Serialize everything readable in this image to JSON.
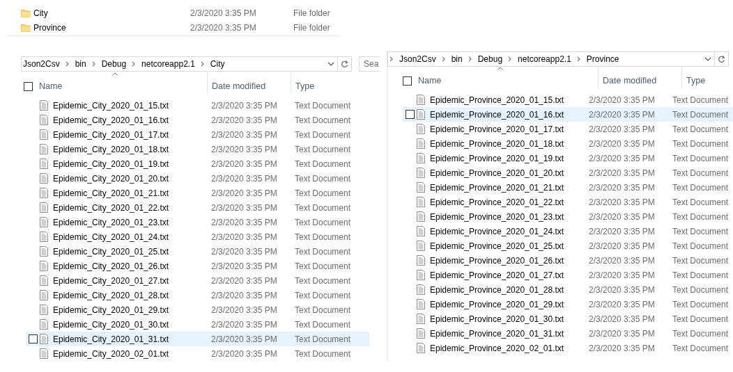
{
  "folders": [
    {
      "name": "City",
      "date_modified": "2/3/2020 3:35 PM",
      "type": "File folder"
    },
    {
      "name": "Province",
      "date_modified": "2/3/2020 3:35 PM",
      "type": "File folder"
    }
  ],
  "panes": [
    {
      "address": {
        "crumbs": [
          "Json2Csv",
          "bin",
          "Debug",
          "netcoreapp2.1",
          "City"
        ],
        "leading_chevron": false
      },
      "search": {
        "placeholder": "Sea"
      },
      "select_all_checked": false,
      "columns": [
        {
          "label": "Name",
          "sorted": true
        },
        {
          "label": "Date modified",
          "sorted": false
        },
        {
          "label": "Type",
          "sorted": false
        }
      ],
      "rows": [
        {
          "name": "Epidemic_City_2020_01_15.txt",
          "date_modified": "2/3/2020 3:35 PM",
          "type": "Text Document",
          "highlighted": false
        },
        {
          "name": "Epidemic_City_2020_01_16.txt",
          "date_modified": "2/3/2020 3:35 PM",
          "type": "Text Document",
          "highlighted": false
        },
        {
          "name": "Epidemic_City_2020_01_17.txt",
          "date_modified": "2/3/2020 3:35 PM",
          "type": "Text Document",
          "highlighted": false
        },
        {
          "name": "Epidemic_City_2020_01_18.txt",
          "date_modified": "2/3/2020 3:35 PM",
          "type": "Text Document",
          "highlighted": false
        },
        {
          "name": "Epidemic_City_2020_01_19.txt",
          "date_modified": "2/3/2020 3:35 PM",
          "type": "Text Document",
          "highlighted": false
        },
        {
          "name": "Epidemic_City_2020_01_20.txt",
          "date_modified": "2/3/2020 3:35 PM",
          "type": "Text Document",
          "highlighted": false
        },
        {
          "name": "Epidemic_City_2020_01_21.txt",
          "date_modified": "2/3/2020 3:35 PM",
          "type": "Text Document",
          "highlighted": false
        },
        {
          "name": "Epidemic_City_2020_01_22.txt",
          "date_modified": "2/3/2020 3:35 PM",
          "type": "Text Document",
          "highlighted": false
        },
        {
          "name": "Epidemic_City_2020_01_23.txt",
          "date_modified": "2/3/2020 3:35 PM",
          "type": "Text Document",
          "highlighted": false
        },
        {
          "name": "Epidemic_City_2020_01_24.txt",
          "date_modified": "2/3/2020 3:35 PM",
          "type": "Text Document",
          "highlighted": false
        },
        {
          "name": "Epidemic_City_2020_01_25.txt",
          "date_modified": "2/3/2020 3:35 PM",
          "type": "Text Document",
          "highlighted": false
        },
        {
          "name": "Epidemic_City_2020_01_26.txt",
          "date_modified": "2/3/2020 3:35 PM",
          "type": "Text Document",
          "highlighted": false
        },
        {
          "name": "Epidemic_City_2020_01_27.txt",
          "date_modified": "2/3/2020 3:35 PM",
          "type": "Text Document",
          "highlighted": false
        },
        {
          "name": "Epidemic_City_2020_01_28.txt",
          "date_modified": "2/3/2020 3:35 PM",
          "type": "Text Document",
          "highlighted": false
        },
        {
          "name": "Epidemic_City_2020_01_29.txt",
          "date_modified": "2/3/2020 3:35 PM",
          "type": "Text Document",
          "highlighted": false
        },
        {
          "name": "Epidemic_City_2020_01_30.txt",
          "date_modified": "2/3/2020 3:35 PM",
          "type": "Text Document",
          "highlighted": false
        },
        {
          "name": "Epidemic_City_2020_01_31.txt",
          "date_modified": "2/3/2020 3:35 PM",
          "type": "Text Document",
          "highlighted": true
        },
        {
          "name": "Epidemic_City_2020_02_01.txt",
          "date_modified": "2/3/2020 3:35 PM",
          "type": "Text Document",
          "highlighted": false
        }
      ]
    },
    {
      "address": {
        "crumbs": [
          "Json2Csv",
          "bin",
          "Debug",
          "netcoreapp2.1",
          "Province"
        ],
        "leading_chevron": true
      },
      "select_all_checked": false,
      "columns": [
        {
          "label": "Name",
          "sorted": true
        },
        {
          "label": "Date modified",
          "sorted": false
        },
        {
          "label": "Type",
          "sorted": false
        }
      ],
      "rows": [
        {
          "name": "Epidemic_Province_2020_01_15.txt",
          "date_modified": "2/3/2020 3:35 PM",
          "type": "Text Document",
          "highlighted": false
        },
        {
          "name": "Epidemic_Province_2020_01_16.txt",
          "date_modified": "2/3/2020 3:35 PM",
          "type": "Text Document",
          "highlighted": true
        },
        {
          "name": "Epidemic_Province_2020_01_17.txt",
          "date_modified": "2/3/2020 3:35 PM",
          "type": "Text Document",
          "highlighted": false
        },
        {
          "name": "Epidemic_Province_2020_01_18.txt",
          "date_modified": "2/3/2020 3:35 PM",
          "type": "Text Document",
          "highlighted": false
        },
        {
          "name": "Epidemic_Province_2020_01_19.txt",
          "date_modified": "2/3/2020 3:35 PM",
          "type": "Text Document",
          "highlighted": false
        },
        {
          "name": "Epidemic_Province_2020_01_20.txt",
          "date_modified": "2/3/2020 3:35 PM",
          "type": "Text Document",
          "highlighted": false
        },
        {
          "name": "Epidemic_Province_2020_01_21.txt",
          "date_modified": "2/3/2020 3:35 PM",
          "type": "Text Document",
          "highlighted": false
        },
        {
          "name": "Epidemic_Province_2020_01_22.txt",
          "date_modified": "2/3/2020 3:35 PM",
          "type": "Text Document",
          "highlighted": false
        },
        {
          "name": "Epidemic_Province_2020_01_23.txt",
          "date_modified": "2/3/2020 3:35 PM",
          "type": "Text Document",
          "highlighted": false
        },
        {
          "name": "Epidemic_Province_2020_01_24.txt",
          "date_modified": "2/3/2020 3:35 PM",
          "type": "Text Document",
          "highlighted": false
        },
        {
          "name": "Epidemic_Province_2020_01_25.txt",
          "date_modified": "2/3/2020 3:35 PM",
          "type": "Text Document",
          "highlighted": false
        },
        {
          "name": "Epidemic_Province_2020_01_26.txt",
          "date_modified": "2/3/2020 3:35 PM",
          "type": "Text Document",
          "highlighted": false
        },
        {
          "name": "Epidemic_Province_2020_01_27.txt",
          "date_modified": "2/3/2020 3:35 PM",
          "type": "Text Document",
          "highlighted": false
        },
        {
          "name": "Epidemic_Province_2020_01_28.txt",
          "date_modified": "2/3/2020 3:35 PM",
          "type": "Text Document",
          "highlighted": false
        },
        {
          "name": "Epidemic_Province_2020_01_29.txt",
          "date_modified": "2/3/2020 3:35 PM",
          "type": "Text Document",
          "highlighted": false
        },
        {
          "name": "Epidemic_Province_2020_01_30.txt",
          "date_modified": "2/3/2020 3:35 PM",
          "type": "Text Document",
          "highlighted": false
        },
        {
          "name": "Epidemic_Province_2020_01_31.txt",
          "date_modified": "2/3/2020 3:35 PM",
          "type": "Text Document",
          "highlighted": false
        },
        {
          "name": "Epidemic_Province_2020_02_01.txt",
          "date_modified": "2/3/2020 3:35 PM",
          "type": "Text Document",
          "highlighted": false
        }
      ]
    }
  ]
}
